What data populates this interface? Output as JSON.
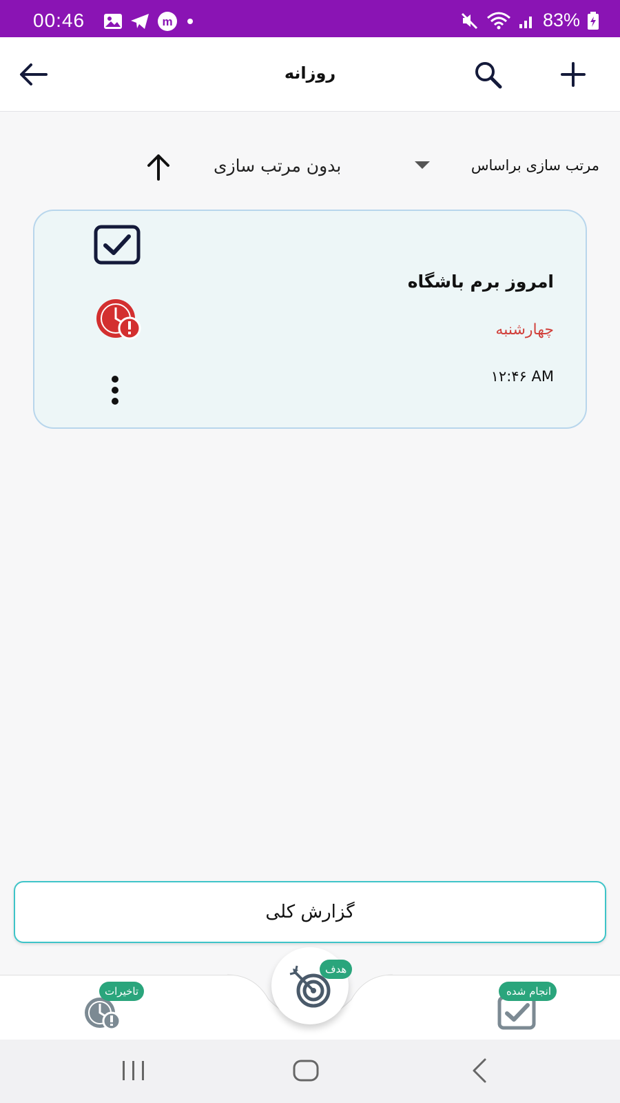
{
  "status_bar": {
    "time": "00:46",
    "battery": "83%",
    "icons": [
      "gallery-icon",
      "telegram-icon",
      "m-app-icon",
      "dot-icon",
      "mute-icon",
      "wifi-icon",
      "signal-icon",
      "battery-icon"
    ]
  },
  "app_bar": {
    "title": "روزانه",
    "icons": [
      "back-arrow-icon",
      "search-icon",
      "add-icon"
    ]
  },
  "sort": {
    "label": "مرتب سازی براساس",
    "value": "بدون مرتب سازی",
    "icons": [
      "dropdown-caret-icon",
      "sort-ascending-icon"
    ]
  },
  "task_card": {
    "title": "امروز برم باشگاه",
    "day": "چهارشنبه",
    "time": "۱۲:۴۶ AM",
    "icons": [
      "done-checkbox-icon",
      "overdue-clock-icon",
      "more-vertical-icon"
    ]
  },
  "report_button": {
    "label": "گزارش کلی"
  },
  "bottom_nav": {
    "delays_label": "تاخیرات",
    "goal_label": "هدف",
    "done_label": "انجام شده",
    "icons": [
      "delays-clock-icon",
      "goal-target-icon",
      "done-check-icon"
    ]
  },
  "system_nav": {
    "icons": [
      "recents-icon",
      "home-icon",
      "back-icon"
    ]
  },
  "colors": {
    "status_bar": "#8a14b4",
    "accent_red": "#d1403b",
    "card_bg": "#edf6f7",
    "card_border": "#b8d6ec",
    "report_border": "#3ec4c8",
    "badge_green": "#2aa57c"
  }
}
